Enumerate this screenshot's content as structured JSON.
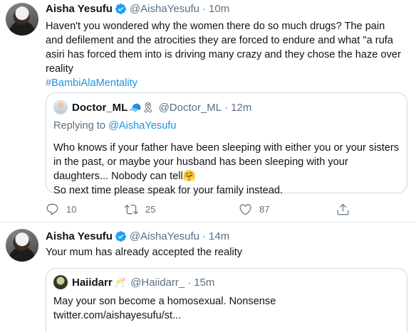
{
  "tweet1": {
    "name": "Aisha Yesufu",
    "handle": "@AishaYesufu",
    "time": "10m",
    "text": "Haven't you wondered why the women there do so much drugs? The pain and defilement and the atrocities they are forced to endure and what \"a rufa asiri has forced them into is driving many crazy and they chose the haze over reality",
    "hashtag": "#BambiAlaMentality",
    "quote": {
      "name": "Doctor_ML",
      "emojis": "🧢🎗",
      "handle": "@Doctor_ML",
      "time": "12m",
      "replying_prefix": "Replying to",
      "replying_to": "@AishaYesufu",
      "text": "Who knows if your father have been sleeping with either you or your sisters in the past, or maybe your husband has been sleeping with your daughters... Nobody can tell🤗",
      "text2": "So next time please speak for your family instead."
    },
    "actions": {
      "replies": "10",
      "retweets": "25",
      "likes": "87"
    }
  },
  "tweet2": {
    "name": "Aisha Yesufu",
    "handle": "@AishaYesufu",
    "time": "14m",
    "text": "Your mum has already accepted the reality",
    "quote": {
      "name": "Haiidarr",
      "emojis": "🥂",
      "handle": "@Haiidarr_",
      "time": "15m",
      "text": "May your son become a homosexual. Nonsense",
      "link": "twitter.com/aishayesufu/st..."
    }
  },
  "colors": {
    "link": "#1b95e0",
    "verified": "#1da1f2",
    "secondary_text": "#5b7083",
    "border": "#cfd9de"
  },
  "icons": [
    "reply-icon",
    "retweet-icon",
    "like-icon",
    "share-icon",
    "verified-badge-icon"
  ]
}
